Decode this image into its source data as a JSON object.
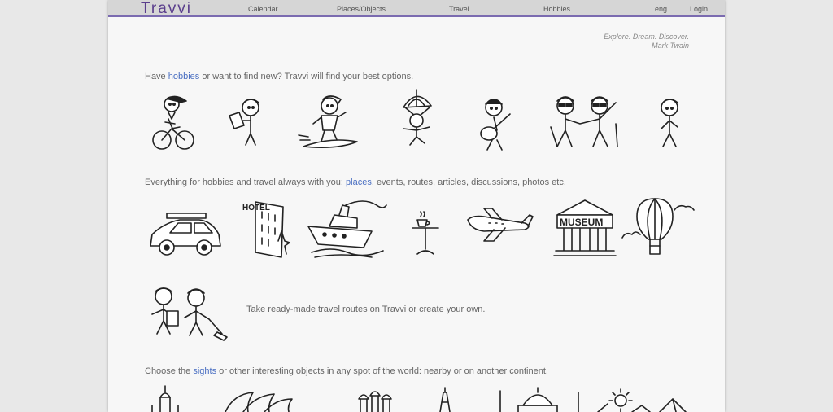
{
  "header": {
    "logo": "Travvi",
    "nav": [
      "Calendar",
      "Places/Objects",
      "Travel",
      "Hobbies"
    ],
    "lang": "eng",
    "login": "Login"
  },
  "quote": {
    "line1": "Explore. Dream. Discover.",
    "line2": "Mark Twain"
  },
  "sections": {
    "hobbies": {
      "pre": "Have ",
      "link": "hobbies",
      "post": " or want to find new? Travvi will find your best options."
    },
    "everything": {
      "pre": "Everything for hobbies and travel always with you: ",
      "link": "places",
      "post": ", events, routes, articles, discussions, photos etc."
    },
    "routes": {
      "text": "Take ready-made travel routes on Travvi or create your own."
    },
    "sights": {
      "pre": "Choose the ",
      "link": "sights",
      "post": " or other interesting objects in any spot of the world: nearby or on another continent."
    }
  },
  "illustrations": {
    "hobbies": [
      "cyclist-icon",
      "reader-icon",
      "surfer-icon",
      "parachutist-icon",
      "guitarist-icon",
      "beach-couple-icon",
      "walker-icon"
    ],
    "places": [
      "car-icon",
      "hotel-icon",
      "ship-icon",
      "cafe-icon",
      "airplane-icon",
      "museum-icon",
      "balloon-icon"
    ],
    "routes": [
      "travellers-icon"
    ],
    "sights": [
      "kremlin-icon",
      "opera-house-icon",
      "st-basil-icon",
      "eiffel-tower-icon",
      "mosque-icon",
      "pyramids-sun-icon"
    ]
  },
  "hotel_sign": "HOTEL",
  "museum_sign": "MUSEUM",
  "colors": {
    "accent": "#7b6bb0",
    "logo": "#5a3e8c",
    "link": "#4a6fc2"
  }
}
